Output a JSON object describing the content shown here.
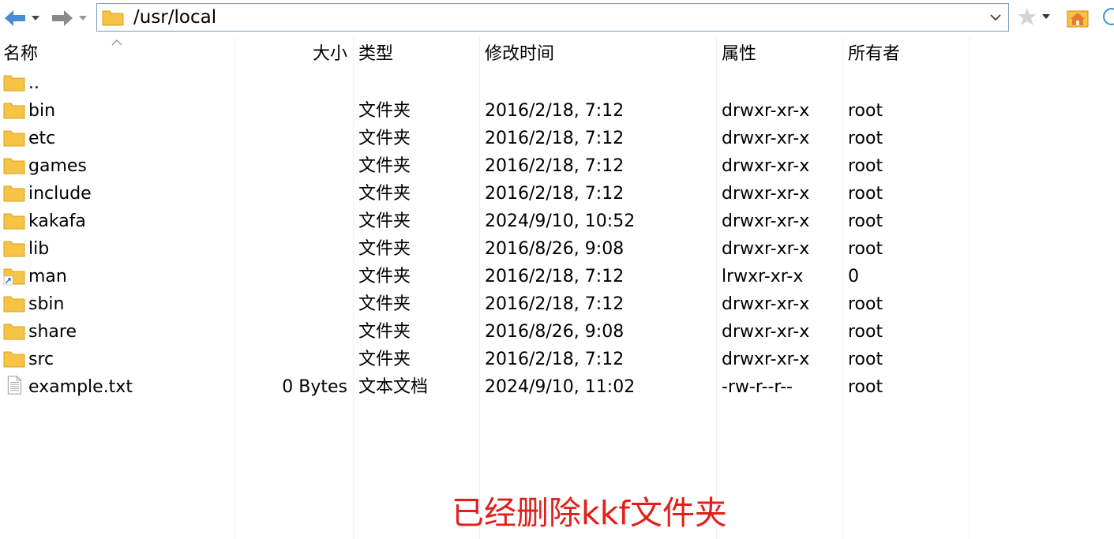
{
  "toolbar": {
    "address": "/usr/local",
    "icons": [
      "back-arrow-icon",
      "forward-arrow-icon",
      "folder-icon",
      "chevron-down-icon",
      "star-icon",
      "home-icon"
    ]
  },
  "columns": {
    "name": "名称",
    "size": "大小",
    "type": "类型",
    "modified": "修改时间",
    "attributes": "属性",
    "owner": "所有者"
  },
  "rows": [
    {
      "icon": "folder-icon",
      "name": "..",
      "size": "",
      "type": "",
      "modified": "",
      "attributes": "",
      "owner": ""
    },
    {
      "icon": "folder-icon",
      "name": "bin",
      "size": "",
      "type": "文件夹",
      "modified": "2016/2/18, 7:12",
      "attributes": "drwxr-xr-x",
      "owner": "root"
    },
    {
      "icon": "folder-icon",
      "name": "etc",
      "size": "",
      "type": "文件夹",
      "modified": "2016/2/18, 7:12",
      "attributes": "drwxr-xr-x",
      "owner": "root"
    },
    {
      "icon": "folder-icon",
      "name": "games",
      "size": "",
      "type": "文件夹",
      "modified": "2016/2/18, 7:12",
      "attributes": "drwxr-xr-x",
      "owner": "root"
    },
    {
      "icon": "folder-icon",
      "name": "include",
      "size": "",
      "type": "文件夹",
      "modified": "2016/2/18, 7:12",
      "attributes": "drwxr-xr-x",
      "owner": "root"
    },
    {
      "icon": "folder-icon",
      "name": "kakafa",
      "size": "",
      "type": "文件夹",
      "modified": "2024/9/10, 10:52",
      "attributes": "drwxr-xr-x",
      "owner": "root"
    },
    {
      "icon": "folder-icon",
      "name": "lib",
      "size": "",
      "type": "文件夹",
      "modified": "2016/8/26, 9:08",
      "attributes": "drwxr-xr-x",
      "owner": "root"
    },
    {
      "icon": "folder-link-icon",
      "name": "man",
      "size": "",
      "type": "文件夹",
      "modified": "2016/2/18, 7:12",
      "attributes": "lrwxr-xr-x",
      "owner": "0"
    },
    {
      "icon": "folder-icon",
      "name": "sbin",
      "size": "",
      "type": "文件夹",
      "modified": "2016/2/18, 7:12",
      "attributes": "drwxr-xr-x",
      "owner": "root"
    },
    {
      "icon": "folder-icon",
      "name": "share",
      "size": "",
      "type": "文件夹",
      "modified": "2016/8/26, 9:08",
      "attributes": "drwxr-xr-x",
      "owner": "root"
    },
    {
      "icon": "folder-icon",
      "name": "src",
      "size": "",
      "type": "文件夹",
      "modified": "2016/2/18, 7:12",
      "attributes": "drwxr-xr-x",
      "owner": "root"
    },
    {
      "icon": "text-file-icon",
      "name": "example.txt",
      "size": "0 Bytes",
      "type": "文本文档",
      "modified": "2024/9/10, 11:02",
      "attributes": "-rw-r--r--",
      "owner": "root"
    }
  ],
  "annotation": "已经删除kkf文件夹",
  "colors": {
    "accent": "#4a8bd6",
    "folder": "#f6c344",
    "annotation": "#e0201b"
  }
}
